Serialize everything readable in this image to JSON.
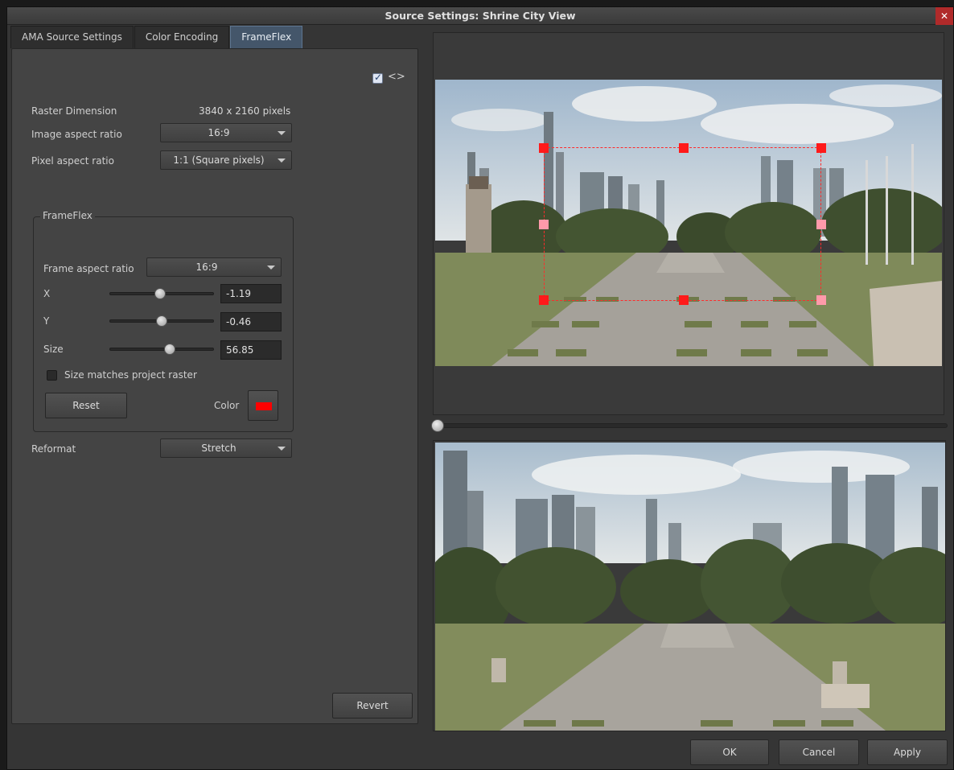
{
  "window": {
    "title": "Source Settings: Shrine City View",
    "close_label": "✕"
  },
  "tabs": [
    {
      "label": "AMA Source Settings",
      "active": false
    },
    {
      "label": "Color Encoding",
      "active": false
    },
    {
      "label": "FrameFlex",
      "active": true
    }
  ],
  "top_toggle": {
    "checked": true,
    "glyph": "<>"
  },
  "raster": {
    "label": "Raster Dimension",
    "value": "3840 x 2160 pixels"
  },
  "image_aspect": {
    "label": "Image aspect ratio",
    "value": "16:9"
  },
  "pixel_aspect": {
    "label": "Pixel aspect ratio",
    "value": "1:1 (Square pixels)"
  },
  "frameflex": {
    "title": "FrameFlex",
    "frame_aspect": {
      "label": "Frame aspect ratio",
      "value": "16:9"
    },
    "x": {
      "label": "X",
      "value": "-1.19"
    },
    "y": {
      "label": "Y",
      "value": "-0.46"
    },
    "size": {
      "label": "Size",
      "value": "56.85"
    },
    "size_matches": {
      "label": "Size matches project raster",
      "checked": false
    },
    "reset_label": "Reset",
    "color_label": "Color",
    "color_value": "#ff0000"
  },
  "reformat": {
    "label": "Reformat",
    "value": "Stretch"
  },
  "revert_label": "Revert",
  "footer": {
    "ok": "OK",
    "cancel": "Cancel",
    "apply": "Apply"
  },
  "colors": {
    "accent_tab": "#44566a",
    "frame_box": "#ff2a2a",
    "close": "#b02a2a"
  }
}
